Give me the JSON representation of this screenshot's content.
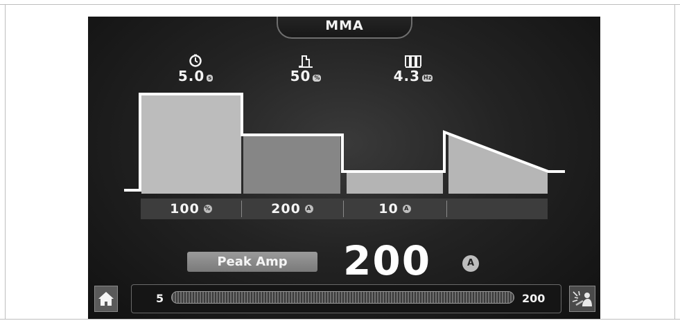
{
  "mode": {
    "label": "MMA"
  },
  "params": [
    {
      "icon": "clock-icon",
      "value": "5.0",
      "unit": "s"
    },
    {
      "icon": "duty-cycle-icon",
      "value": "50",
      "unit": "%"
    },
    {
      "icon": "pulse-frequency-icon",
      "value": "4.3",
      "unit": "Hz"
    }
  ],
  "phases": [
    {
      "value": "100",
      "unit": "%"
    },
    {
      "value": "200",
      "unit": "A"
    },
    {
      "value": "10",
      "unit": "A"
    },
    {
      "value": "",
      "unit": ""
    }
  ],
  "selected": {
    "label": "Peak Amp",
    "value": "200",
    "unit": "A"
  },
  "slider": {
    "min": "5",
    "max": "200",
    "level": 1.0
  },
  "buttons": {
    "home": "home-icon",
    "weld": "welding-icon"
  }
}
